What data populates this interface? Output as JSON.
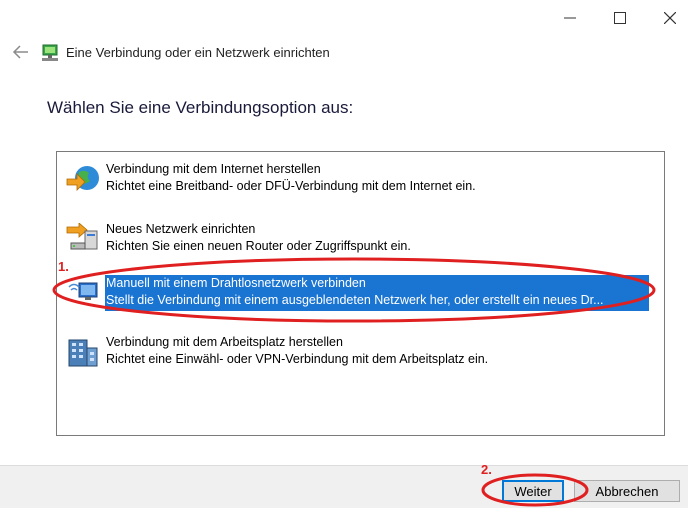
{
  "window": {
    "title": "Eine Verbindung oder ein Netzwerk einrichten"
  },
  "heading": "Wählen Sie eine Verbindungsoption aus:",
  "options": [
    {
      "title": "Verbindung mit dem Internet herstellen",
      "desc": "Richtet eine Breitband- oder DFÜ-Verbindung mit dem Internet ein.",
      "icon": "globe-icon"
    },
    {
      "title": "Neues Netzwerk einrichten",
      "desc": "Richten Sie einen neuen Router oder Zugriffspunkt ein.",
      "icon": "router-icon"
    },
    {
      "title": "Manuell mit einem Drahtlosnetzwerk verbinden",
      "desc": "Stellt die Verbindung mit einem ausgeblendeten Netzwerk her, oder erstellt ein neues Dr...",
      "icon": "wireless-network-icon"
    },
    {
      "title": "Verbindung mit dem Arbeitsplatz herstellen",
      "desc": "Richtet eine Einwähl- oder VPN-Verbindung mit dem Arbeitsplatz ein.",
      "icon": "workplace-building-icon"
    }
  ],
  "buttons": {
    "next": "Weiter",
    "cancel": "Abbrechen"
  },
  "annotations": {
    "step1": "1.",
    "step2": "2."
  },
  "colors": {
    "selection": "#1a74d2",
    "annotation": "#e02020"
  }
}
